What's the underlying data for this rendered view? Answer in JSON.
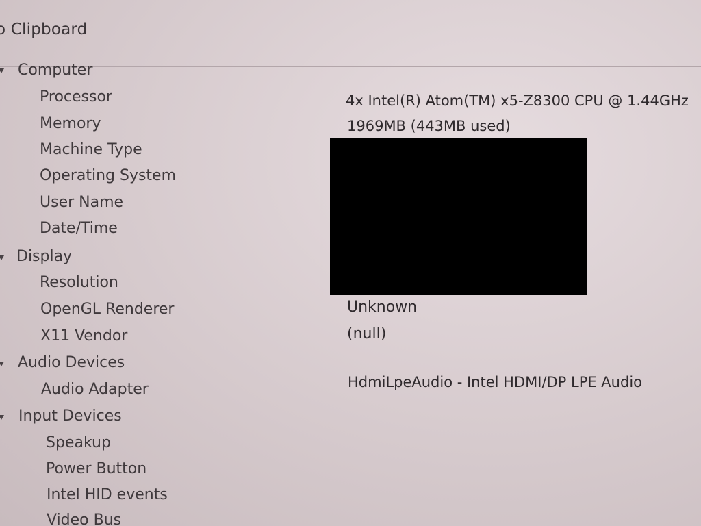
{
  "toolbar": {
    "copy_label": "o Clipboard"
  },
  "colors": {
    "background": "#d9cdd0",
    "text": "#3c3639",
    "redaction": "#000000"
  },
  "tree": {
    "computer": {
      "label": "Computer",
      "items": [
        {
          "label": "Processor",
          "value": "4x Intel(R) Atom(TM) x5-Z8300  CPU @ 1.44GHz"
        },
        {
          "label": "Memory",
          "value": "1969MB (443MB used)"
        },
        {
          "label": "Machine Type",
          "value": ""
        },
        {
          "label": "Operating System",
          "value": ""
        },
        {
          "label": "User Name",
          "value": ""
        },
        {
          "label": "Date/Time",
          "value": ""
        }
      ]
    },
    "display": {
      "label": "Display",
      "items": [
        {
          "label": "Resolution",
          "value": ""
        },
        {
          "label": "OpenGL Renderer",
          "value": "Unknown"
        },
        {
          "label": "X11 Vendor",
          "value": "(null)"
        }
      ]
    },
    "audio": {
      "label": "Audio Devices",
      "items": [
        {
          "label": "Audio Adapter",
          "value": "HdmiLpeAudio - Intel HDMI/DP LPE Audio"
        }
      ]
    },
    "input": {
      "label": "Input Devices",
      "items": [
        {
          "label": "Speakup"
        },
        {
          "label": "Power Button"
        },
        {
          "label": "Intel HID events"
        },
        {
          "label": "Video Bus"
        }
      ]
    }
  }
}
